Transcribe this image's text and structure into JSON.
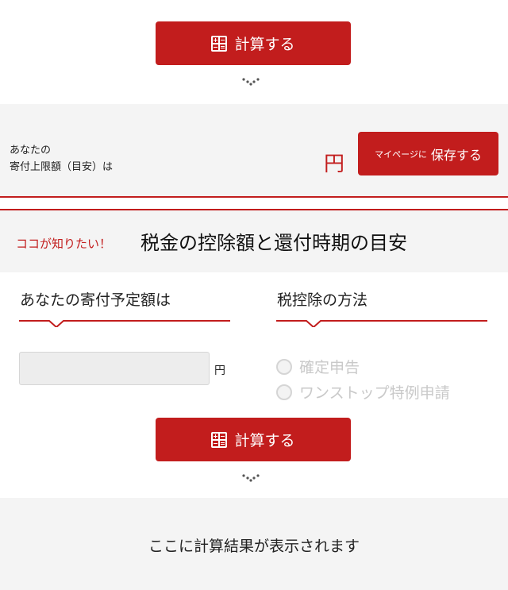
{
  "top_calc_button": {
    "label": "計算する"
  },
  "limit_section": {
    "label_line1": "あなたの",
    "label_line2": "寄付上限額（目安）は",
    "currency": "円",
    "save_small": "マイページに",
    "save_big": "保存する"
  },
  "deduction_section": {
    "callout": "ココが知りたい！",
    "heading": "税金の控除額と還付時期の目安"
  },
  "donation_column": {
    "heading": "あなたの寄付予定額は",
    "input_value": "",
    "input_placeholder": "",
    "currency": "円"
  },
  "method_column": {
    "heading": "税控除の方法",
    "options": [
      "確定申告",
      "ワンストップ特例申請"
    ]
  },
  "bottom_calc_button": {
    "label": "計算する"
  },
  "result": {
    "message": "ここに計算結果が表示されます"
  },
  "colors": {
    "accent": "#c21d1d",
    "band": "#f4f4f4",
    "disabled": "#c9c9c9"
  },
  "icons": {
    "calculator": "calculator-icon",
    "dots": "scroll-down-dots-icon"
  }
}
